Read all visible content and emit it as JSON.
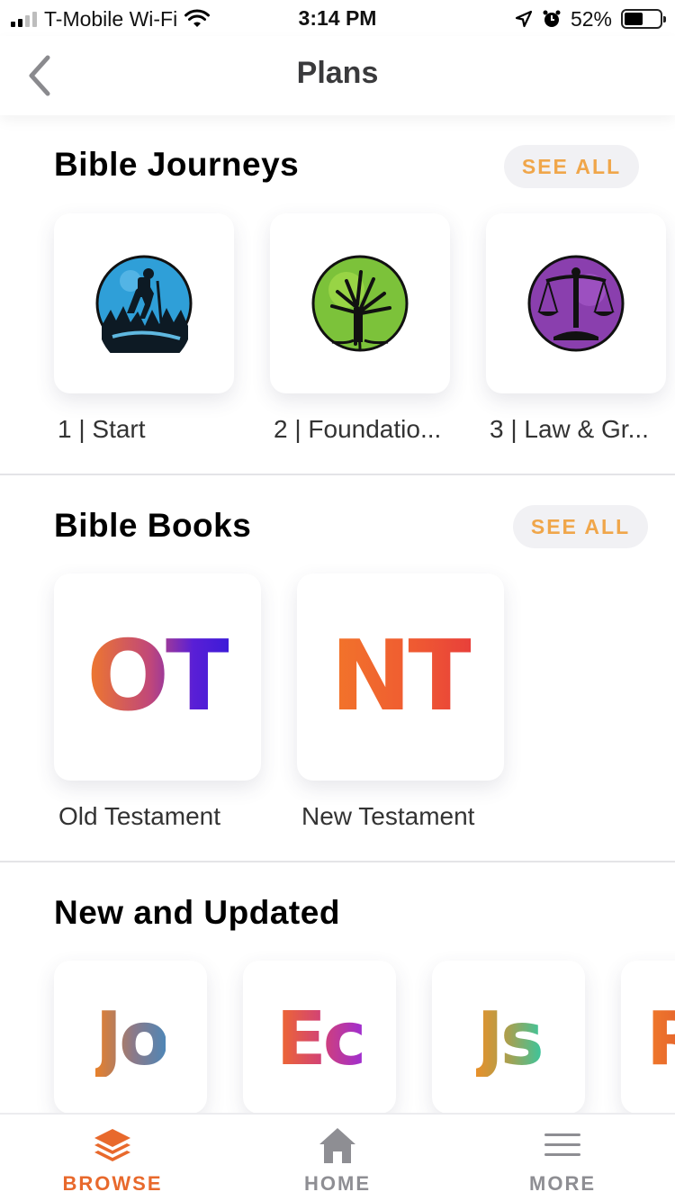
{
  "status_bar": {
    "carrier": "T-Mobile Wi-Fi",
    "time": "3:14 PM",
    "battery": "52%",
    "battery_level": 0.52
  },
  "nav": {
    "title": "Plans",
    "back_icon": "chevron-left-icon"
  },
  "bible_journeys": {
    "title": "Bible Journeys",
    "see_all": "SEE ALL",
    "items": [
      {
        "label": "1 | Start",
        "icon": "hiker-icon"
      },
      {
        "label": "2 | Foundatio...",
        "icon": "tree-icon"
      },
      {
        "label": "3 | Law & Gr...",
        "icon": "scales-icon"
      }
    ]
  },
  "bible_books": {
    "title": "Bible Books",
    "see_all": "SEE ALL",
    "items": [
      {
        "label": "Old Testament",
        "abbr": "OT"
      },
      {
        "label": "New Testament",
        "abbr": "NT"
      }
    ]
  },
  "new_and_updated": {
    "title": "New and Updated",
    "items": [
      {
        "abbr": "Jo"
      },
      {
        "abbr": "Ec"
      },
      {
        "abbr": "Js"
      },
      {
        "abbr": "R"
      }
    ]
  },
  "tab_bar": {
    "browse": "BROWSE",
    "home": "HOME",
    "more": "MORE",
    "active_color": "#e8692c",
    "inactive_color": "#8e8e93"
  }
}
